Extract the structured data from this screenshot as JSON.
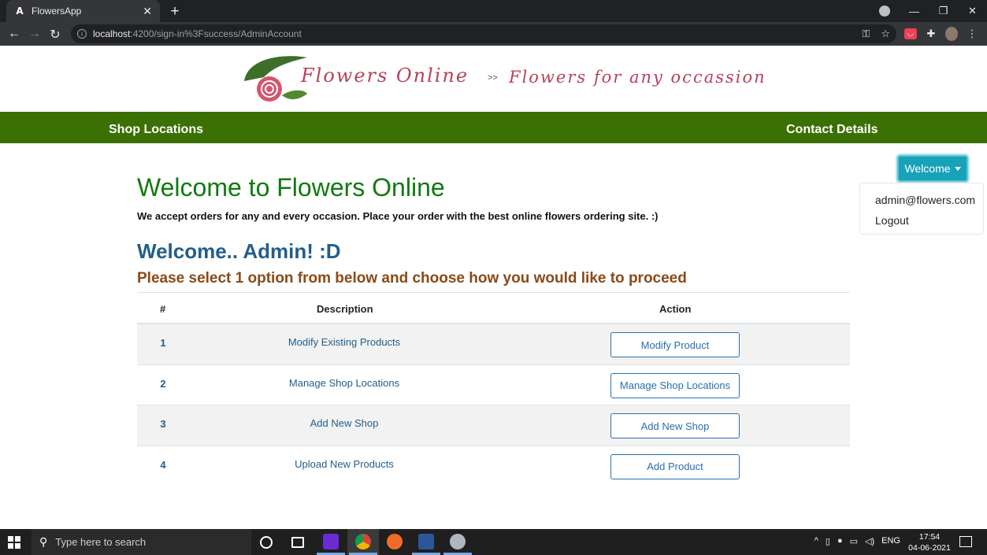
{
  "browser": {
    "tab_title": "FlowersApp",
    "tab_favicon": "A",
    "url_host": "localhost",
    "url_path": ":4200/sign-in%3Fsuccess/AdminAccount"
  },
  "site": {
    "brand": "Flowers Online",
    "separator": ">>",
    "tagline": "Flowers for any occassion",
    "nav_left": "Shop Locations",
    "nav_right": "Contact Details"
  },
  "user_menu": {
    "button_label": "Welcome",
    "items": [
      "admin@flowers.com",
      "Logout"
    ]
  },
  "main": {
    "heading": "Welcome to Flowers Online",
    "lead": "We accept orders for any and every occasion. Place your order with the best online flowers ordering site. :)",
    "greeting": "Welcome.. Admin! :D",
    "instruction": "Please select 1 option from below and choose how you would like to proceed"
  },
  "table": {
    "headers": [
      "#",
      "Description",
      "Action"
    ],
    "rows": [
      {
        "num": "1",
        "description": "Modify Existing Products",
        "action": "Modify Product"
      },
      {
        "num": "2",
        "description": "Manage Shop Locations",
        "action": "Manage Shop Locations"
      },
      {
        "num": "3",
        "description": "Add New Shop",
        "action": "Add New Shop"
      },
      {
        "num": "4",
        "description": "Upload New Products",
        "action": "Add Product"
      }
    ]
  },
  "taskbar": {
    "search_placeholder": "Type here to search",
    "language": "ENG",
    "time": "17:54",
    "date": "04-06-2021"
  },
  "colors": {
    "nav_green": "#3b7004",
    "heading_green": "#107a10",
    "welcome_teal": "#17a2b8",
    "link_blue": "#235e8a",
    "instruction_brown": "#8a4a17",
    "brand_pink": "#b8405a"
  }
}
